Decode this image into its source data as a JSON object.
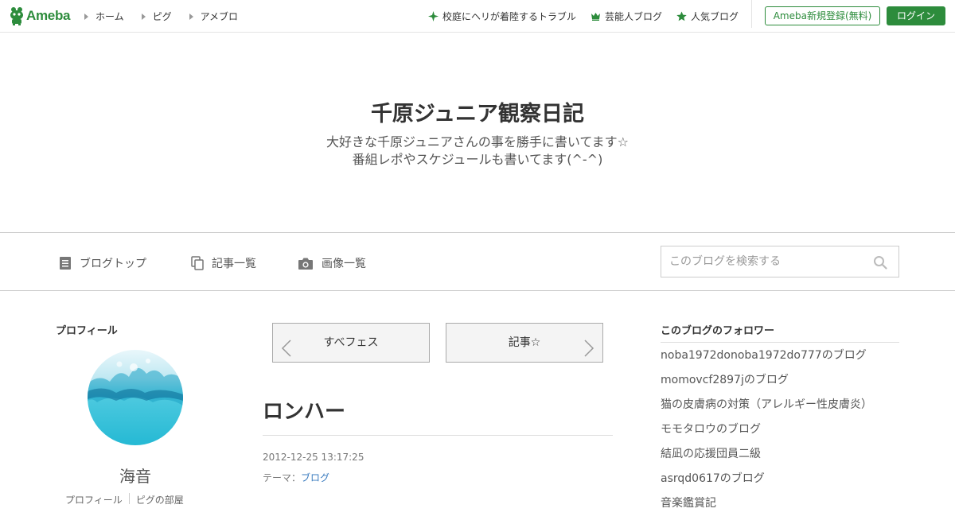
{
  "topbar": {
    "logo_text": "Ameba",
    "nav": [
      {
        "label": "ホーム"
      },
      {
        "label": "ピグ"
      },
      {
        "label": "アメブロ"
      }
    ],
    "right": [
      {
        "label": "校庭にヘリが着陸するトラブル",
        "icon": "sparkle-icon"
      },
      {
        "label": "芸能人ブログ",
        "icon": "crown-icon"
      },
      {
        "label": "人気ブログ",
        "icon": "star-icon"
      }
    ],
    "register_label": "Ameba新規登録(無料)",
    "login_label": "ログイン",
    "brand_color": "#2d8c3c"
  },
  "header": {
    "title": "千原ジュニア観察日記",
    "desc_line1": "大好きな千原ジュニアさんの事を勝手に書いてます☆",
    "desc_line2": "番組レポやスケジュールも書いてます(^-^)"
  },
  "blognav": {
    "items": [
      {
        "label": "ブログトップ",
        "icon": "document-icon"
      },
      {
        "label": "記事一覧",
        "icon": "copy-icon"
      },
      {
        "label": "画像一覧",
        "icon": "camera-icon"
      }
    ],
    "search_placeholder": "このブログを検索する"
  },
  "profile": {
    "heading": "プロフィール",
    "name": "海音",
    "links": [
      "プロフィール",
      "ピグの部屋"
    ]
  },
  "article": {
    "prev_label": "すべフェス",
    "next_label": "記事☆",
    "title": "ロンハー",
    "date": "2012-12-25 13:17:25",
    "theme_prefix": "テーマ：",
    "theme": "ブログ"
  },
  "followers": {
    "heading": "このブログのフォロワー",
    "items": [
      "noba1972donoba1972do777のブログ",
      "momovcf2897jのブログ",
      "猫の皮膚病の対策（アレルギー性皮膚炎）",
      "モモタロウのブログ",
      "結凪の応援団員二級",
      "asrqd0617のブログ",
      "音楽鑑賞記"
    ]
  }
}
